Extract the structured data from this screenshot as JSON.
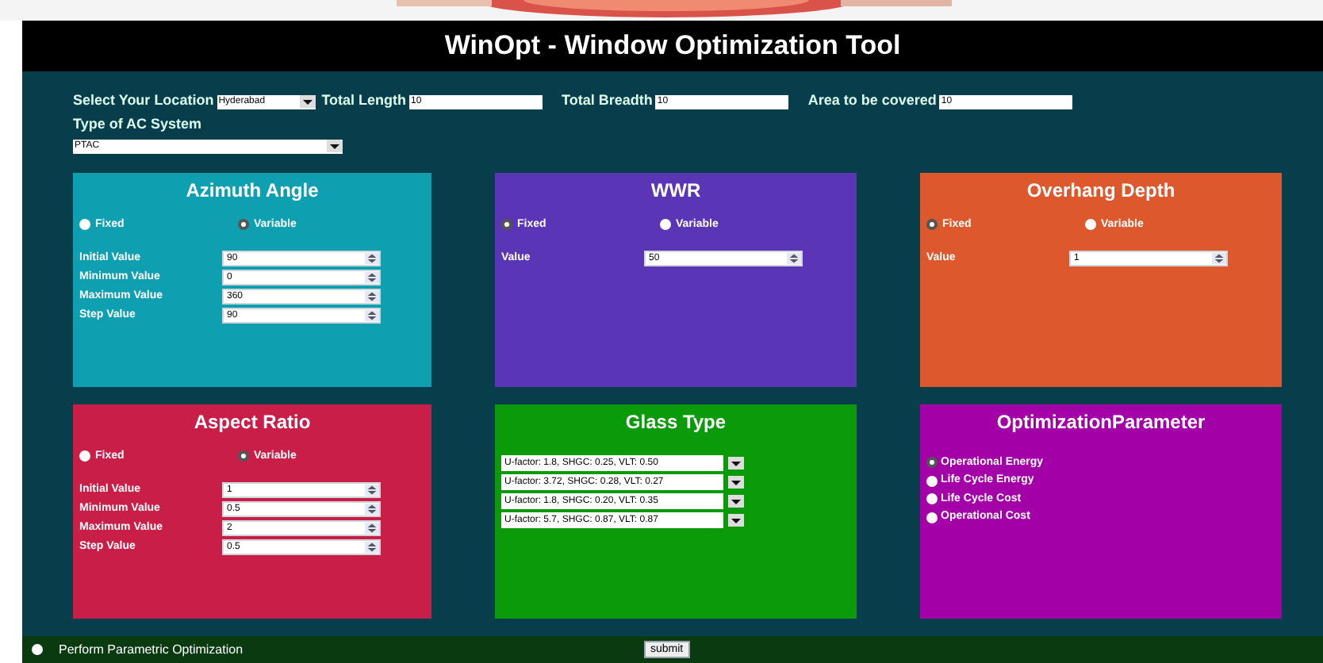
{
  "title": "WinOpt - Window Optimization Tool",
  "fields": [
    {
      "kind": "select",
      "label": "Select Your Location",
      "value": "Hyderabad"
    },
    {
      "kind": "text",
      "label": "Total Length",
      "value": "10"
    },
    {
      "kind": "text",
      "label": "Total Breadth",
      "value": "10"
    },
    {
      "kind": "text",
      "label": "Area to be covered",
      "value": "10"
    }
  ],
  "ac_system": {
    "label": "Type of AC System",
    "value": "PTAC"
  },
  "panels": [
    {
      "kind": "spin",
      "title": "Azimuth Angle",
      "color": "#0e9fb0",
      "modes": [
        {
          "label": "Fixed",
          "selected": false
        },
        {
          "label": "Variable",
          "selected": true
        }
      ],
      "fields": [
        {
          "label": "Initial Value",
          "value": "90"
        },
        {
          "label": "Minimum Value",
          "value": "0"
        },
        {
          "label": "Maximum Value",
          "value": "360"
        },
        {
          "label": "Step Value",
          "value": "90"
        }
      ]
    },
    {
      "kind": "spin",
      "title": "WWR",
      "color": "#5a35b5",
      "modes": [
        {
          "label": "Fixed",
          "selected": true
        },
        {
          "label": "Variable",
          "selected": false
        }
      ],
      "fields": [
        {
          "label": "Value",
          "value": "50"
        }
      ]
    },
    {
      "kind": "spin",
      "title": "Overhang Depth",
      "color": "#dd582c",
      "modes": [
        {
          "label": "Fixed",
          "selected": true
        },
        {
          "label": "Variable",
          "selected": false
        }
      ],
      "fields": [
        {
          "label": "Value",
          "value": "1"
        }
      ]
    },
    {
      "kind": "spin",
      "title": "Aspect Ratio",
      "color": "#c81e48",
      "modes": [
        {
          "label": "Fixed",
          "selected": false
        },
        {
          "label": "Variable",
          "selected": true
        }
      ],
      "fields": [
        {
          "label": "Initial Value",
          "value": "1"
        },
        {
          "label": "Minimum Value",
          "value": "0.5"
        },
        {
          "label": "Maximum Value",
          "value": "2"
        },
        {
          "label": "Step Value",
          "value": "0.5"
        }
      ]
    },
    {
      "kind": "glass",
      "title": "Glass Type",
      "color": "#0a9a0a",
      "options": [
        {
          "value": "U-factor: 1.8, SHGC: 0.25, VLT: 0.50"
        },
        {
          "value": "U-factor: 3.72, SHGC: 0.28, VLT: 0.27"
        },
        {
          "value": "U-factor: 1.8, SHGC: 0.20, VLT: 0.35"
        },
        {
          "value": "U-factor: 5.7, SHGC: 0.87, VLT: 0.87"
        }
      ]
    },
    {
      "kind": "options",
      "title": "OptimizationParameter",
      "color": "#a400a8",
      "options": [
        {
          "label": "Operational Energy",
          "selected": true
        },
        {
          "label": "Life Cycle Energy",
          "selected": false
        },
        {
          "label": "Life Cycle Cost",
          "selected": false
        },
        {
          "label": "Operational Cost",
          "selected": false
        }
      ]
    }
  ],
  "footer": {
    "option": {
      "label": "Perform Parametric Optimization",
      "selected": false
    },
    "button": "submit"
  }
}
